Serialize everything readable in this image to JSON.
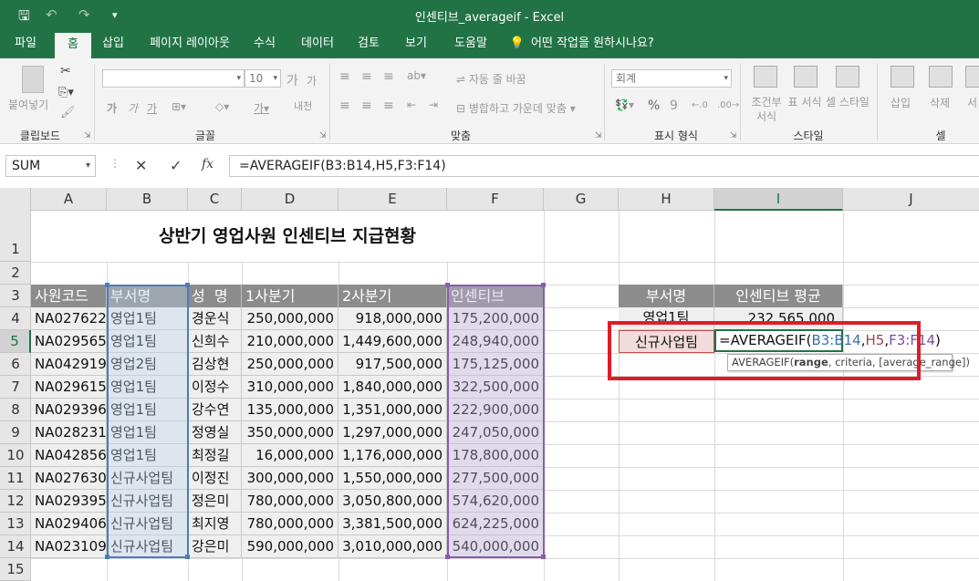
{
  "window": {
    "title": "인센티브_averageif  -  Excel"
  },
  "quick_access": {
    "save": "🖫",
    "undo": "↶",
    "redo": "↷",
    "customize": "▾"
  },
  "tabs": [
    "파일",
    "홈",
    "삽입",
    "페이지 레이아웃",
    "수식",
    "데이터",
    "검토",
    "보기",
    "도움말"
  ],
  "tellme": "어떤 작업을 원하시나요?",
  "ribbon": {
    "clipboard": {
      "paste": "붙여넣기",
      "label": "클립보드"
    },
    "font": {
      "name": "",
      "size": "10",
      "grow": "가",
      "shrink": "가",
      "bold": "가",
      "italic": "가",
      "underline": "가",
      "phonetic": "내천",
      "label": "글꼴"
    },
    "alignment": {
      "wrap": "자동 줄 바꿈",
      "merge": "병합하고 가운데 맞춤",
      "label": "맞춤"
    },
    "number": {
      "format": "회계",
      "percent": "%",
      "comma": "9",
      "inc": "←.0",
      "dec": ".00→",
      "label": "표시 형식"
    },
    "styles": {
      "conditional": "조건부 서식",
      "table": "표 서식",
      "cell": "셀 스타일",
      "label": "스타일"
    },
    "cells": {
      "insert": "삽입",
      "delete": "삭제",
      "format": "서",
      "label": "셀"
    }
  },
  "formula_bar": {
    "name_box": "SUM",
    "cancel": "✕",
    "enter": "✓",
    "fx": "fx",
    "formula": "=AVERAGEIF(B3:B14,H5,F3:F14)"
  },
  "columns": [
    "A",
    "B",
    "C",
    "D",
    "E",
    "F",
    "G",
    "H",
    "I",
    "J"
  ],
  "rows": [
    "1",
    "2",
    "3",
    "4",
    "5",
    "6",
    "7",
    "8",
    "9",
    "10",
    "11",
    "12",
    "13",
    "14",
    "15"
  ],
  "sheet": {
    "title": "상반기 영업사원 인센티브 지급현황",
    "headers": [
      "사원코드",
      "부서명",
      "성  명",
      "1사분기",
      "2사분기",
      "인센티브"
    ],
    "data": [
      [
        "NA027622",
        "영업1팀",
        "경운식",
        "250,000,000",
        "918,000,000",
        "175,200,000"
      ],
      [
        "NA029565",
        "영업1팀",
        "신희수",
        "210,000,000",
        "1,449,600,000",
        "248,940,000"
      ],
      [
        "NA042919",
        "영업2팀",
        "김상현",
        "250,000,000",
        "917,500,000",
        "175,125,000"
      ],
      [
        "NA029615",
        "영업1팀",
        "이정수",
        "310,000,000",
        "1,840,000,000",
        "322,500,000"
      ],
      [
        "NA029396",
        "영업1팀",
        "강수연",
        "135,000,000",
        "1,351,000,000",
        "222,900,000"
      ],
      [
        "NA028231",
        "영업1팀",
        "정영실",
        "350,000,000",
        "1,297,000,000",
        "247,050,000"
      ],
      [
        "NA042856",
        "영업1팀",
        "최정길",
        "16,000,000",
        "1,176,000,000",
        "178,800,000"
      ],
      [
        "NA027630",
        "신규사업팀",
        "이정진",
        "300,000,000",
        "1,550,000,000",
        "277,500,000"
      ],
      [
        "NA029395",
        "신규사업팀",
        "정은미",
        "780,000,000",
        "3,050,800,000",
        "574,620,000"
      ],
      [
        "NA029406",
        "신규사업팀",
        "최지영",
        "780,000,000",
        "3,381,500,000",
        "624,225,000"
      ],
      [
        "NA023109",
        "신규사업팀",
        "강은미",
        "590,000,000",
        "3,010,000,000",
        "540,000,000"
      ]
    ],
    "summary": {
      "header_dept": "부서명",
      "header_avg": "인센티브 평균",
      "row1_dept": "영업1팀",
      "row1_avg": "232,565,000",
      "row2_dept": "신규사업팀"
    },
    "editing": {
      "prefix": "=AVERAGEIF(",
      "arg1": "B3:B14",
      "sep1": ",",
      "arg2": "H5",
      "sep2": ",",
      "arg3": "F3:F14",
      "suffix": ")"
    },
    "tooltip": {
      "fn": "AVERAGEIF(",
      "arg_bold": "range",
      "rest": ", criteria, [average_range])"
    }
  },
  "colors": {
    "excel_green": "#217346",
    "highlight_red": "#e01c24",
    "range_blue": "#4a7ebb",
    "range_purple": "#8a5ab0"
  }
}
